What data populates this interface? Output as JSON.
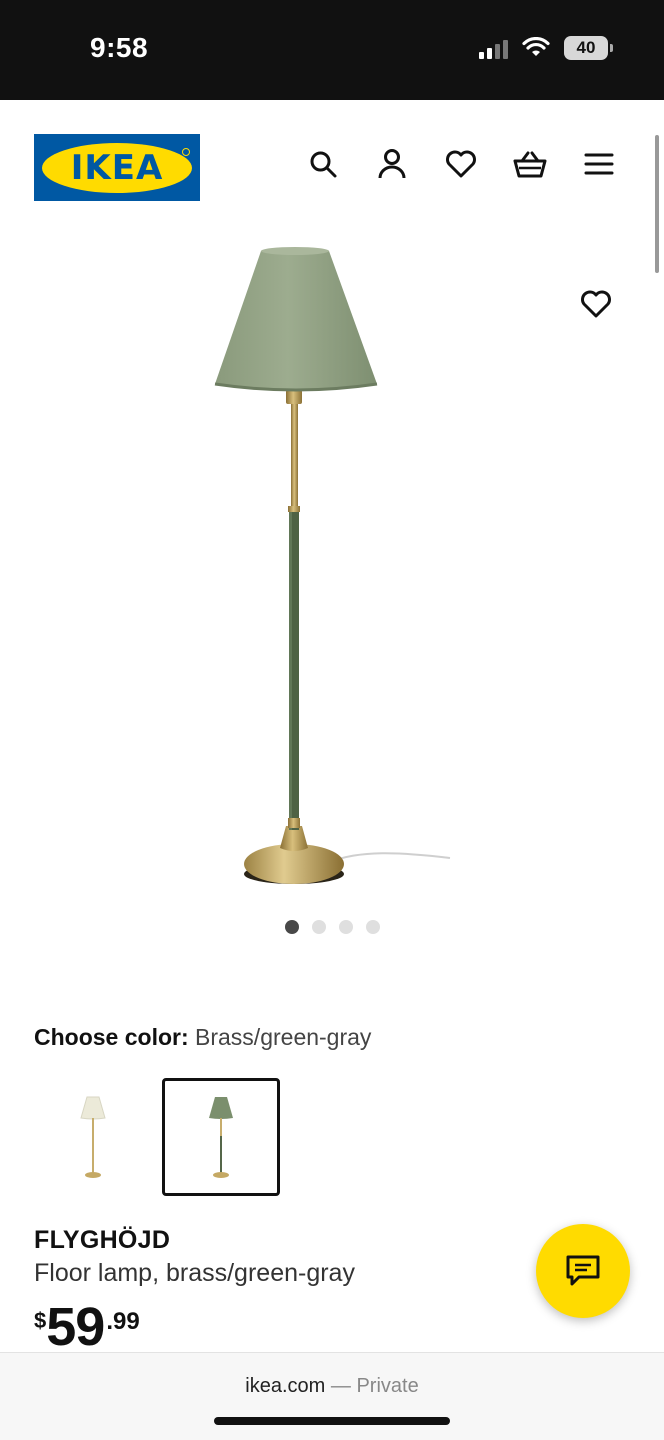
{
  "status_bar": {
    "time": "9:58",
    "battery": "40"
  },
  "brand": {
    "logo_text": "IKEA",
    "blue": "#0058a3",
    "yellow": "#ffdb00"
  },
  "nav": {
    "icons": [
      "search-icon",
      "account-icon",
      "favorites-icon",
      "cart-icon",
      "menu-icon"
    ]
  },
  "gallery": {
    "image_count": 4,
    "active_index": 0
  },
  "color_picker": {
    "label": "Choose color:",
    "selected_value": "Brass/green-gray",
    "options": [
      {
        "name": "Brass/white",
        "shade": "#efeddf",
        "selected": false
      },
      {
        "name": "Brass/green-gray",
        "shade": "#7b8f6d",
        "selected": true
      }
    ]
  },
  "product": {
    "name": "FLYGHÖJD",
    "description": "Floor lamp, brass/green-gray",
    "price": {
      "currency": "$",
      "integer": "59",
      "decimal": ".99"
    }
  },
  "browser": {
    "url": "ikea.com",
    "mode": "— Private"
  }
}
